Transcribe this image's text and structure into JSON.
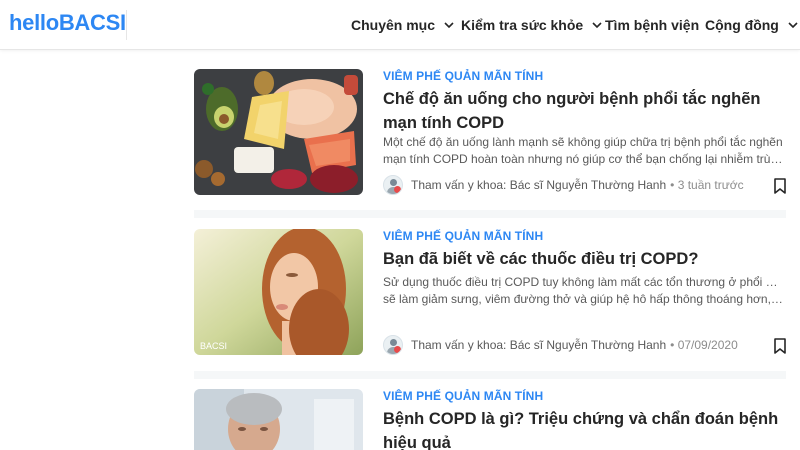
{
  "brand": {
    "logo_hello": "hello",
    "logo_bacsi": "BACSI"
  },
  "nav": [
    {
      "label": "Chuyên mục",
      "has_dropdown": true
    },
    {
      "label": "Kiểm tra sức khỏe",
      "has_dropdown": true
    },
    {
      "label": "Tìm bệnh viện",
      "has_dropdown": false
    },
    {
      "label": "Cộng đồng",
      "has_dropdown": true
    }
  ],
  "articles": [
    {
      "category": "VIÊM PHẾ QUẢN MÃN TÍNH",
      "title": "Chế độ ăn uống cho người bệnh phổi tắc nghẽn mạn tính COPD",
      "desc_line1": "Một chế độ ăn uống lành mạnh sẽ không giúp chữa trị bệnh phổi tắc nghẽn",
      "desc_line2": "mạn tính COPD hoàn toàn nhưng nó giúp cơ thể bạn chống lại nhiễm trùng,...",
      "reviewer": "Tham vấn y khoa: Bác sĩ Nguyễn Thường Hanh",
      "time": "• 3 tuần trước"
    },
    {
      "category": "VIÊM PHẾ QUẢN MÃN TÍNH",
      "title": "Bạn đã biết về các thuốc điều trị COPD?",
      "desc_line1": "Sử dụng thuốc điều trị COPD tuy không làm mất các tổn thương ở phổi nhưng",
      "desc_line2": "sẽ làm giảm sưng, viêm đường thở và giúp hệ hô hấp thông thoáng hơn, tăng...",
      "reviewer": "Tham vấn y khoa: Bác sĩ Nguyễn Thường Hanh",
      "time": "• 07/09/2020",
      "thumb_watermark": "BACSI"
    },
    {
      "category": "VIÊM PHẾ QUẢN MÃN TÍNH",
      "title": "Bệnh COPD là gì? Triệu chứng và chẩn đoán bệnh hiệu quả"
    }
  ],
  "colors": {
    "accent": "#2d87f3",
    "text": "#262626",
    "muted": "#595959"
  },
  "icons": [
    "chevron-down-icon",
    "bookmark-icon",
    "reviewer-avatar"
  ]
}
